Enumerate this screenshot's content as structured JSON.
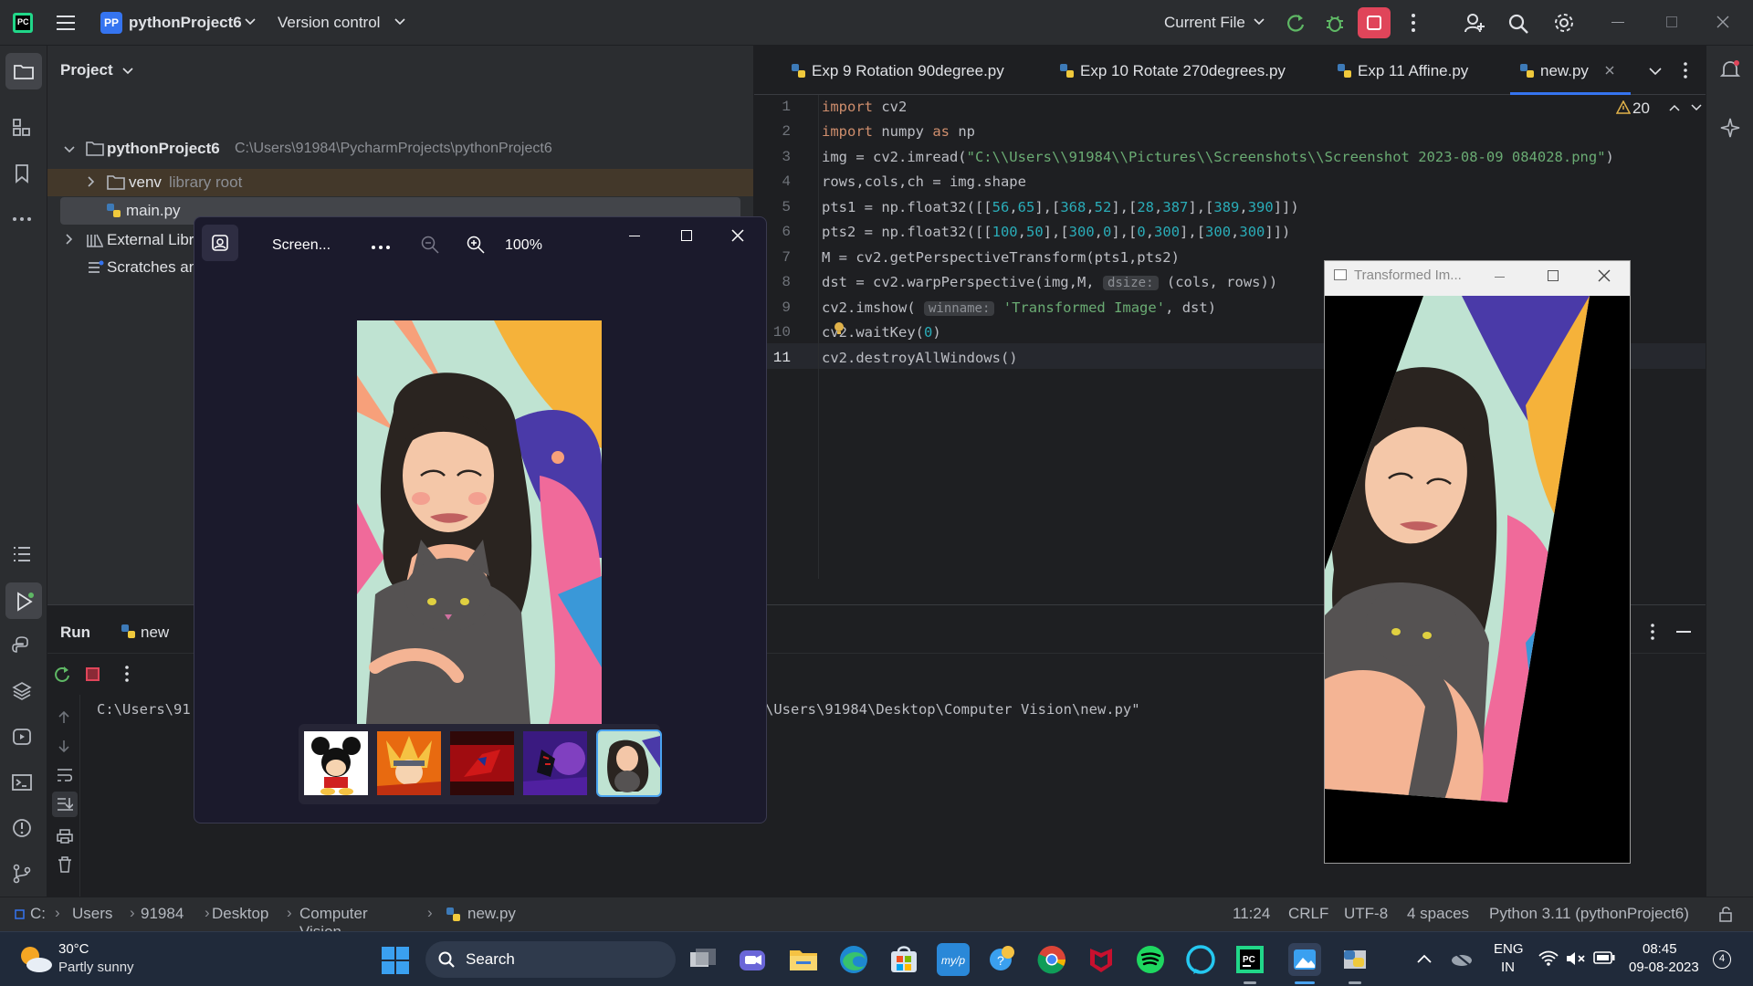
{
  "titlebar": {
    "project_badge": "PP",
    "project_name": "pythonProject6",
    "version_control": "Version control",
    "run_config": "Current File"
  },
  "project_panel": {
    "header": "Project",
    "root_name": "pythonProject6",
    "root_path": "C:\\Users\\91984\\PycharmProjects\\pythonProject6",
    "venv": "venv",
    "venv_hint": "library root",
    "main_file": "main.py",
    "external_libraries": "External Libraries",
    "scratches": "Scratches and Consoles"
  },
  "editor": {
    "tabs": [
      {
        "label": "Exp 9 Rotation 90degree.py"
      },
      {
        "label": "Exp 10 Rotate 270degrees.py"
      },
      {
        "label": "Exp 11 Affine.py"
      },
      {
        "label": "new.py"
      }
    ],
    "warnings_count": "20",
    "line_numbers": [
      "1",
      "2",
      "3",
      "4",
      "5",
      "6",
      "7",
      "8",
      "9",
      "10",
      "11"
    ],
    "lines": {
      "l1a": "import",
      "l1b": " cv2",
      "l2a": "import",
      "l2b": " numpy ",
      "l2c": "as",
      "l2d": " np",
      "l3a": "img = cv2.imread(",
      "l3b": "\"C:\\\\Users\\\\91984\\\\Pictures\\\\Screenshots\\\\Screenshot 2023-08-09 084028.png\"",
      "l3c": ")",
      "l4": "rows,cols,ch = img.shape",
      "l5a": "pts1 = np.float32([[",
      "l5n1": "56",
      "l5s1": ",",
      "l5n2": "65",
      "l5s2": "],[",
      "l5n3": "368",
      "l5s3": ",",
      "l5n4": "52",
      "l5s4": "],[",
      "l5n5": "28",
      "l5s5": ",",
      "l5n6": "387",
      "l5s6": "],[",
      "l5n7": "389",
      "l5s7": ",",
      "l5n8": "390",
      "l5s8": "]])",
      "l6a": "pts2 = np.float32([[",
      "l6n1": "100",
      "l6s1": ",",
      "l6n2": "50",
      "l6s2": "],[",
      "l6n3": "300",
      "l6s3": ",",
      "l6n4": "0",
      "l6s4": "],[",
      "l6n5": "0",
      "l6s5": ",",
      "l6n6": "300",
      "l6s6": "],[",
      "l6n7": "300",
      "l6s7": ",",
      "l6n8": "300",
      "l6s8": "]])",
      "l7": "M = cv2.getPerspectiveTransform(pts1,pts2)",
      "l8a": "dst = cv2.warpPerspective(img,M, ",
      "l8hint": "dsize:",
      "l8b": " (cols, rows))",
      "l9a": "cv2.imshow( ",
      "l9hint": "winname:",
      "l9b": " 'Transformed Image'",
      "l9c": ", dst)",
      "l10a": "cv2.waitKey(",
      "l10n": "0",
      "l10b": ")",
      "l11": "cv2.destroyAllWindows()"
    }
  },
  "run_panel": {
    "title": "Run",
    "tab": "new",
    "output_left": "C:\\Users\\91",
    "output_right": "\\Users\\91984\\Desktop\\Computer Vision\\new.py\""
  },
  "photos_window": {
    "title": "Screen...",
    "zoom": "100%"
  },
  "cv_window": {
    "title": "Transformed Im..."
  },
  "status_bar": {
    "crumbs": [
      "C:",
      "Users",
      "91984",
      "Desktop",
      "Computer Vision",
      "new.py"
    ],
    "position": "11:24",
    "line_ending": "CRLF",
    "encoding": "UTF-8",
    "indent": "4 spaces",
    "interpreter": "Python 3.11 (pythonProject6)"
  },
  "taskbar": {
    "temperature": "30°C",
    "weather": "Partly sunny",
    "search_label": "Search",
    "lang1": "ENG",
    "lang2": "IN",
    "time": "08:45",
    "date": "09-08-2023",
    "notif_count": "4"
  },
  "colors": {
    "accent": "#3574f0",
    "keyword": "#cf8e6d",
    "string": "#6aab73",
    "number": "#2aacb8",
    "stop_red": "#e0455a"
  }
}
